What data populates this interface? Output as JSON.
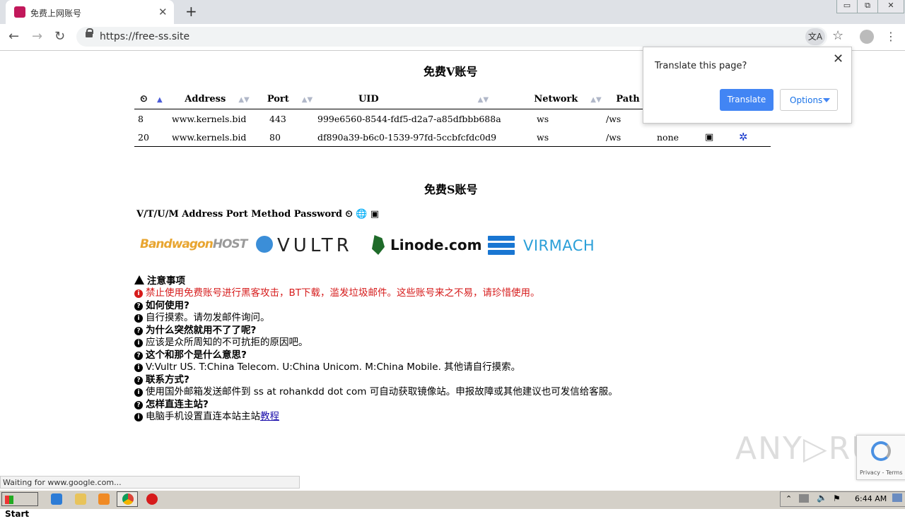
{
  "browser": {
    "tab_title": "免费上网账号",
    "tab_close": "✕",
    "new_tab": "+",
    "url": "https://free-ss.site",
    "win_minimize": "▭",
    "win_restore": "⧉",
    "win_close": "✕",
    "back": "←",
    "forward": "→",
    "reload": "↻",
    "star": "☆",
    "menu": "⋮",
    "translate_glyph": "文A"
  },
  "v_section": {
    "heading": "免费V账号",
    "columns": {
      "clock": "⏲",
      "sort_up": "▲",
      "sort_both": "▲▼",
      "address": "Address",
      "port": "Port",
      "uid": "UID",
      "network": "Network",
      "path": "Path"
    },
    "rows": [
      {
        "num": "8",
        "address": "www.kernels.bid",
        "port": "443",
        "uid": "999e6560-8544-fdf5-d2a7-a85dfbbb688a",
        "network": "ws",
        "path": "/ws",
        "tls": "",
        "qr": "▣",
        "cfg": ""
      },
      {
        "num": "20",
        "address": "www.kernels.bid",
        "port": "80",
        "uid": "df890a39-b6c0-1539-97fd-5ccbfcfdc0d9",
        "network": "ws",
        "path": "/ws",
        "tls": "none",
        "qr": "▣",
        "cfg": "✲"
      }
    ]
  },
  "s_section": {
    "heading": "免费S账号",
    "line": "V/T/U/M Address Port Method Password ⏲ 🌐 ▣"
  },
  "logos": {
    "bandwagon": "Bandwagon",
    "bandwagon_host": "HOST",
    "vultr": "VULTR",
    "linode": "Linode.com",
    "virmach": "VIRMACH"
  },
  "notes": {
    "notice_title": "注意事项",
    "notice_text": "禁止使用免费账号进行黑客攻击，BT下载，滥发垃圾邮件。这些账号来之不易，请珍惜使用。",
    "q1": "如何使用?",
    "a1": "自行摸索。请勿发邮件询问。",
    "q2": "为什么突然就用不了了呢?",
    "a2": "应该是众所周知的不可抗拒的原因吧。",
    "q3": "这个和那个是什么意思?",
    "a3": "V:Vultr US. T:China Telecom. U:China Unicom. M:China Mobile. 其他请自行摸索。",
    "q4": "联系方式?",
    "a4": "使用国外邮箱发送邮件到 ss at rohankdd dot com 可自动获取镜像站。申报故障或其他建议也可发信给客服。",
    "q5": "怎样直连主站?",
    "a5": "电脑手机设置直连本站主站",
    "a5_link": "教程",
    "q_glyph": "?",
    "i_glyph": "i"
  },
  "translate_bubble": {
    "title": "Translate this page?",
    "close": "✕",
    "translate_button": "Translate",
    "options_button": "Options"
  },
  "status": {
    "text": "Waiting for www.google.com..."
  },
  "watermark": "ANY▷RUN",
  "recaptcha": {
    "text": "Privacy - Terms"
  },
  "taskbar": {
    "start": "Start",
    "clock": "6:44 AM"
  }
}
